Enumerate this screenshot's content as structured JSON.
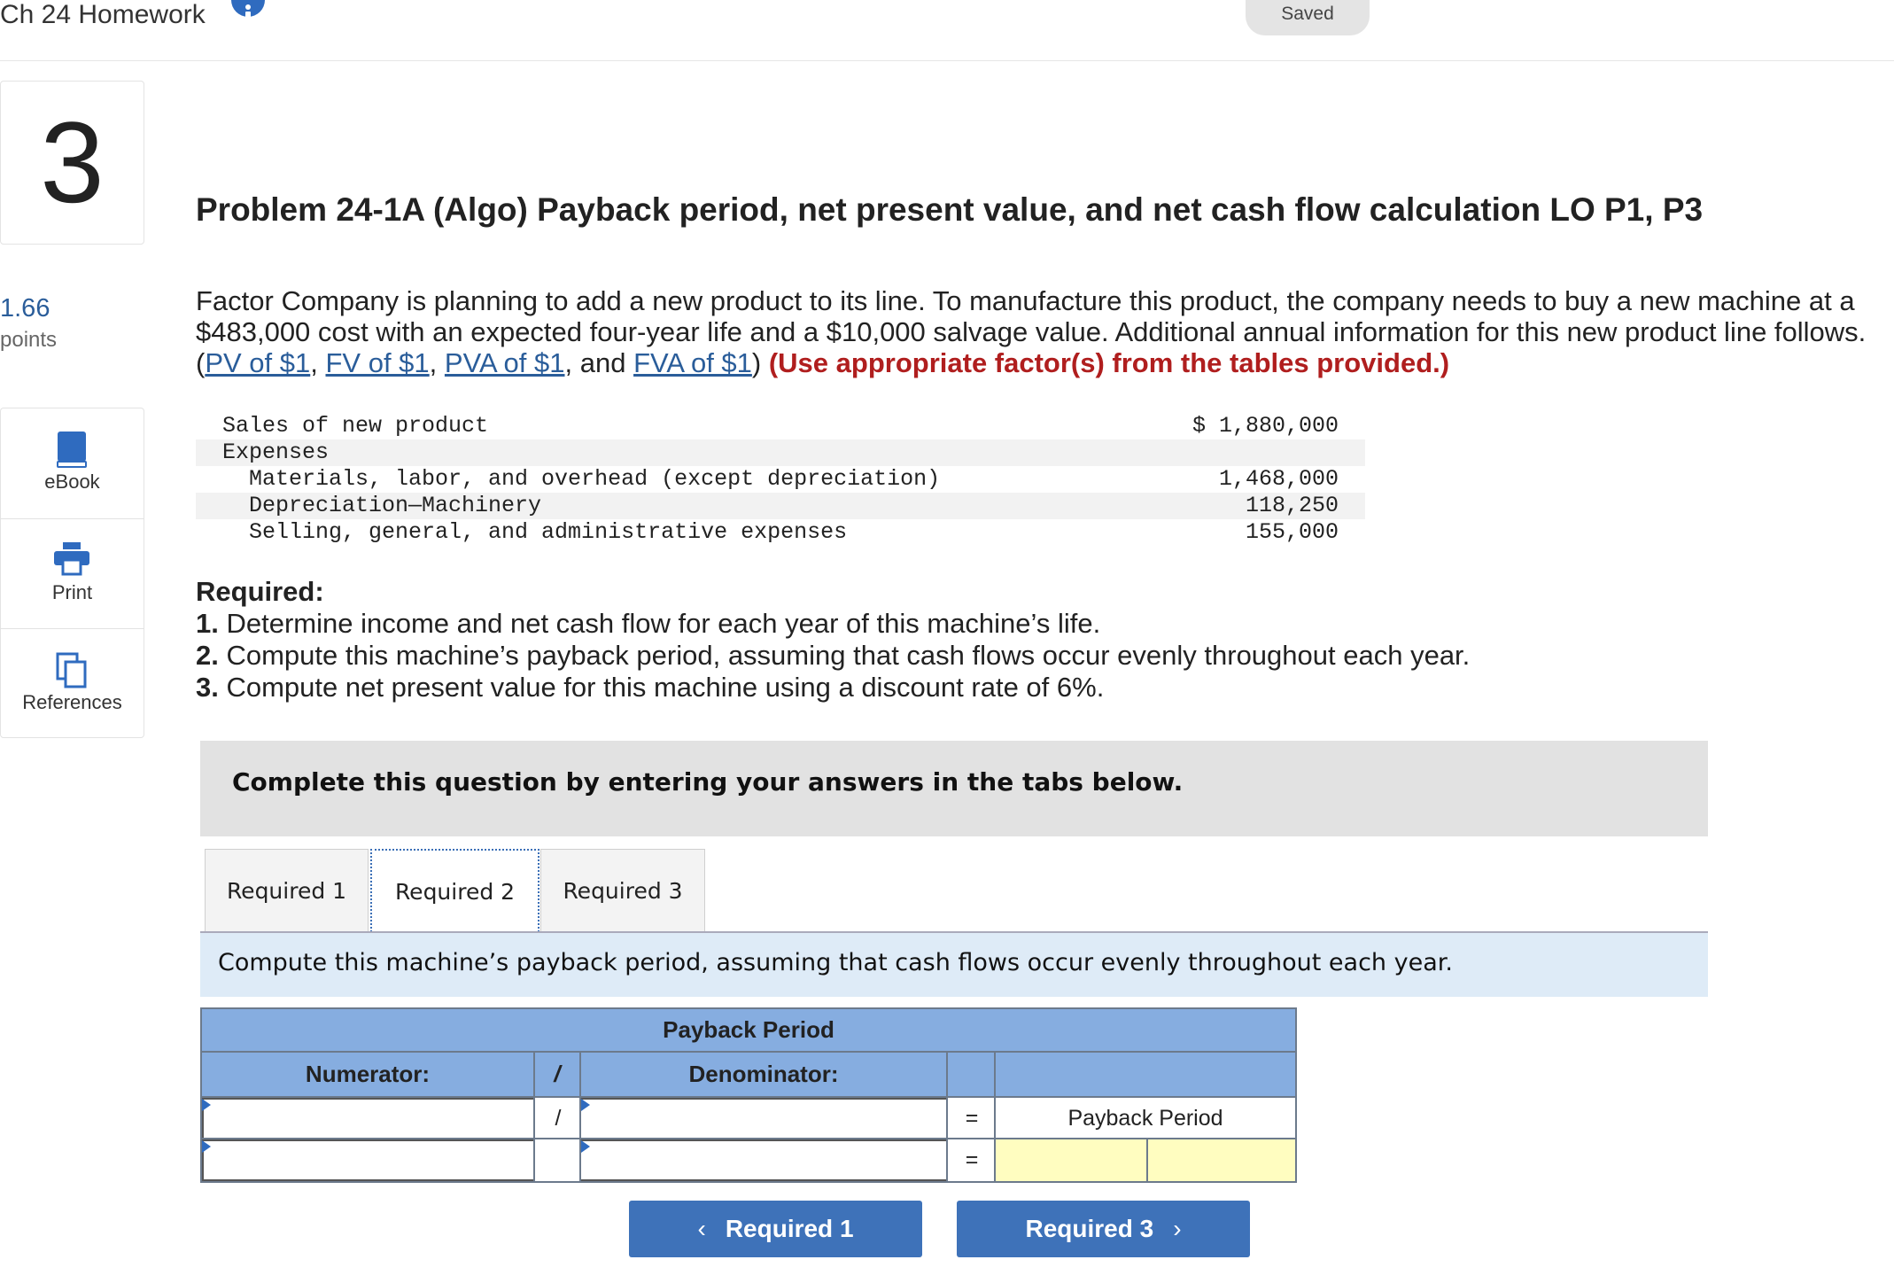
{
  "header": {
    "assignment_title": "Ch 24 Homework",
    "info_icon": "info-circle-icon",
    "status": "Saved"
  },
  "question": {
    "number": "3",
    "points_value": "1.66",
    "points_label": "points"
  },
  "tools": [
    {
      "label": "eBook",
      "icon": "book-icon"
    },
    {
      "label": "Print",
      "icon": "printer-icon"
    },
    {
      "label": "References",
      "icon": "copy-pages-icon"
    }
  ],
  "problem": {
    "title": "Problem 24-1A (Algo) Payback period, net present value, and net cash flow calculation LO P1, P3",
    "intro": "Factor Company is planning to add a new product to its line. To manufacture this product, the company needs to buy a new machine at a $483,000 cost with an expected four-year life and a $10,000 salvage value. Additional annual information for this new product line follows. (",
    "links": [
      "PV of $1",
      "FV of $1",
      "PVA of $1",
      "FVA of $1"
    ],
    "sep1": ", ",
    "sep2": ", ",
    "sep3": ", and ",
    "close_paren": ") ",
    "emphasis": "(Use appropriate factor(s) from the tables provided.)"
  },
  "data_table": [
    {
      "label": "Sales of new product",
      "value": "$ 1,880,000",
      "indent": 0
    },
    {
      "label": "Expenses",
      "value": "",
      "indent": 0
    },
    {
      "label": "Materials, labor, and overhead (except depreciation)",
      "value": "1,468,000",
      "indent": 1
    },
    {
      "label": "Depreciation—Machinery",
      "value": "118,250",
      "indent": 1
    },
    {
      "label": "Selling, general, and administrative expenses",
      "value": "155,000",
      "indent": 1
    }
  ],
  "required": {
    "heading": "Required:",
    "items": [
      {
        "num": "1.",
        "text": " Determine income and net cash flow for each year of this machine’s life."
      },
      {
        "num": "2.",
        "text": " Compute this machine’s payback period, assuming that cash flows occur evenly throughout each year."
      },
      {
        "num": "3.",
        "text": " Compute net present value for this machine using a discount rate of 6%."
      }
    ]
  },
  "instructions": "Complete this question by entering your answers in the tabs below.",
  "tabs": [
    {
      "label": "Required 1",
      "active": false
    },
    {
      "label": "Required 2",
      "active": true
    },
    {
      "label": "Required 3",
      "active": false
    }
  ],
  "prompt": "Compute this machine’s payback period, assuming that cash flows occur evenly throughout each year.",
  "payback_table": {
    "title": "Payback Period",
    "col_numerator": "Numerator:",
    "col_slash": "/",
    "col_denominator": "Denominator:",
    "row1": {
      "numerator": "",
      "slash": "/",
      "denominator": "",
      "equals": "=",
      "result_label": "Payback Period"
    },
    "row2": {
      "numerator": "",
      "slash": "",
      "denominator": "",
      "equals": "=",
      "result_a": "",
      "result_b": ""
    }
  },
  "nav": {
    "prev_label": "Required 1",
    "next_label": "Required 3"
  },
  "colors": {
    "accent_blue": "#3e72b9",
    "header_blue": "#86ade0",
    "link_blue": "#2a5d9a",
    "emphasis_red": "#b01e1e",
    "yellow_cell": "#fffdc0",
    "prompt_bg": "#deebf7"
  }
}
